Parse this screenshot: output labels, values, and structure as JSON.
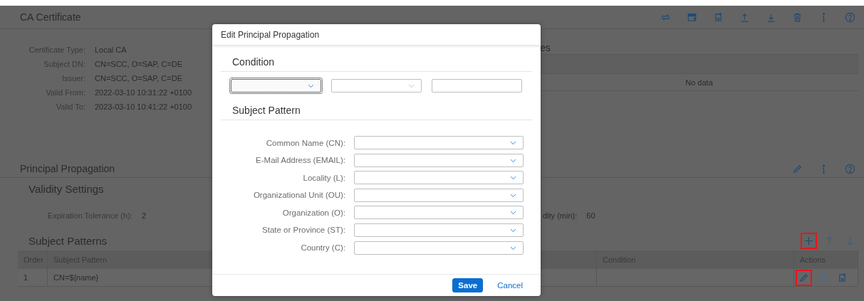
{
  "ca_certificate": {
    "title": "CA Certificate",
    "fields": [
      {
        "label": "Certificate Type:",
        "value": "Local CA"
      },
      {
        "label": "Subject DN:",
        "value": "CN=SCC, O=SAP, C=DE"
      },
      {
        "label": "Issuer:",
        "value": "CN=SCC, O=SAP, C=DE"
      },
      {
        "label": "Valid From:",
        "value": "2022-03-10 10:31:22 +0100"
      },
      {
        "label": "Valid To:",
        "value": "2023-03-10 10:41:22 +0100"
      }
    ]
  },
  "side_section": {
    "title_fragment": "es",
    "table_message": "No data"
  },
  "principal_propagation": {
    "title": "Principal Propagation",
    "validity_settings": {
      "title": "Validity Settings",
      "fields": [
        {
          "label": "Expiration Tolerance (h):",
          "value": "2"
        },
        {
          "label": "dity (min):",
          "value": "60"
        }
      ]
    },
    "subject_patterns": {
      "title": "Subject Patterns",
      "add_highlighted": true,
      "columns": [
        "Order",
        "Subject Pattern",
        "Condition",
        "Actions"
      ],
      "rows": [
        {
          "order": "1",
          "subject_pattern": "CN=${name}",
          "edit_highlighted": true
        }
      ]
    }
  },
  "dialog": {
    "title": "Edit Principal Propagation",
    "condition": {
      "title": "Condition",
      "fields": [
        {
          "kind": "select",
          "focused": true
        },
        {
          "kind": "select",
          "focused": false
        },
        {
          "kind": "input",
          "focused": false
        }
      ]
    },
    "subject_pattern": {
      "title": "Subject Pattern",
      "fields": [
        {
          "label": "Common Name (CN):"
        },
        {
          "label": "E-Mail Address (EMAIL):"
        },
        {
          "label": "Locality (L):"
        },
        {
          "label": "Organizational Unit (OU):"
        },
        {
          "label": "Organization (O):"
        },
        {
          "label": "State or Province (ST):"
        },
        {
          "label": "Country (C):"
        }
      ]
    },
    "buttons": [
      {
        "label": "Save",
        "kind": "emphasized"
      },
      {
        "label": "Cancel",
        "kind": "transparent"
      }
    ]
  }
}
